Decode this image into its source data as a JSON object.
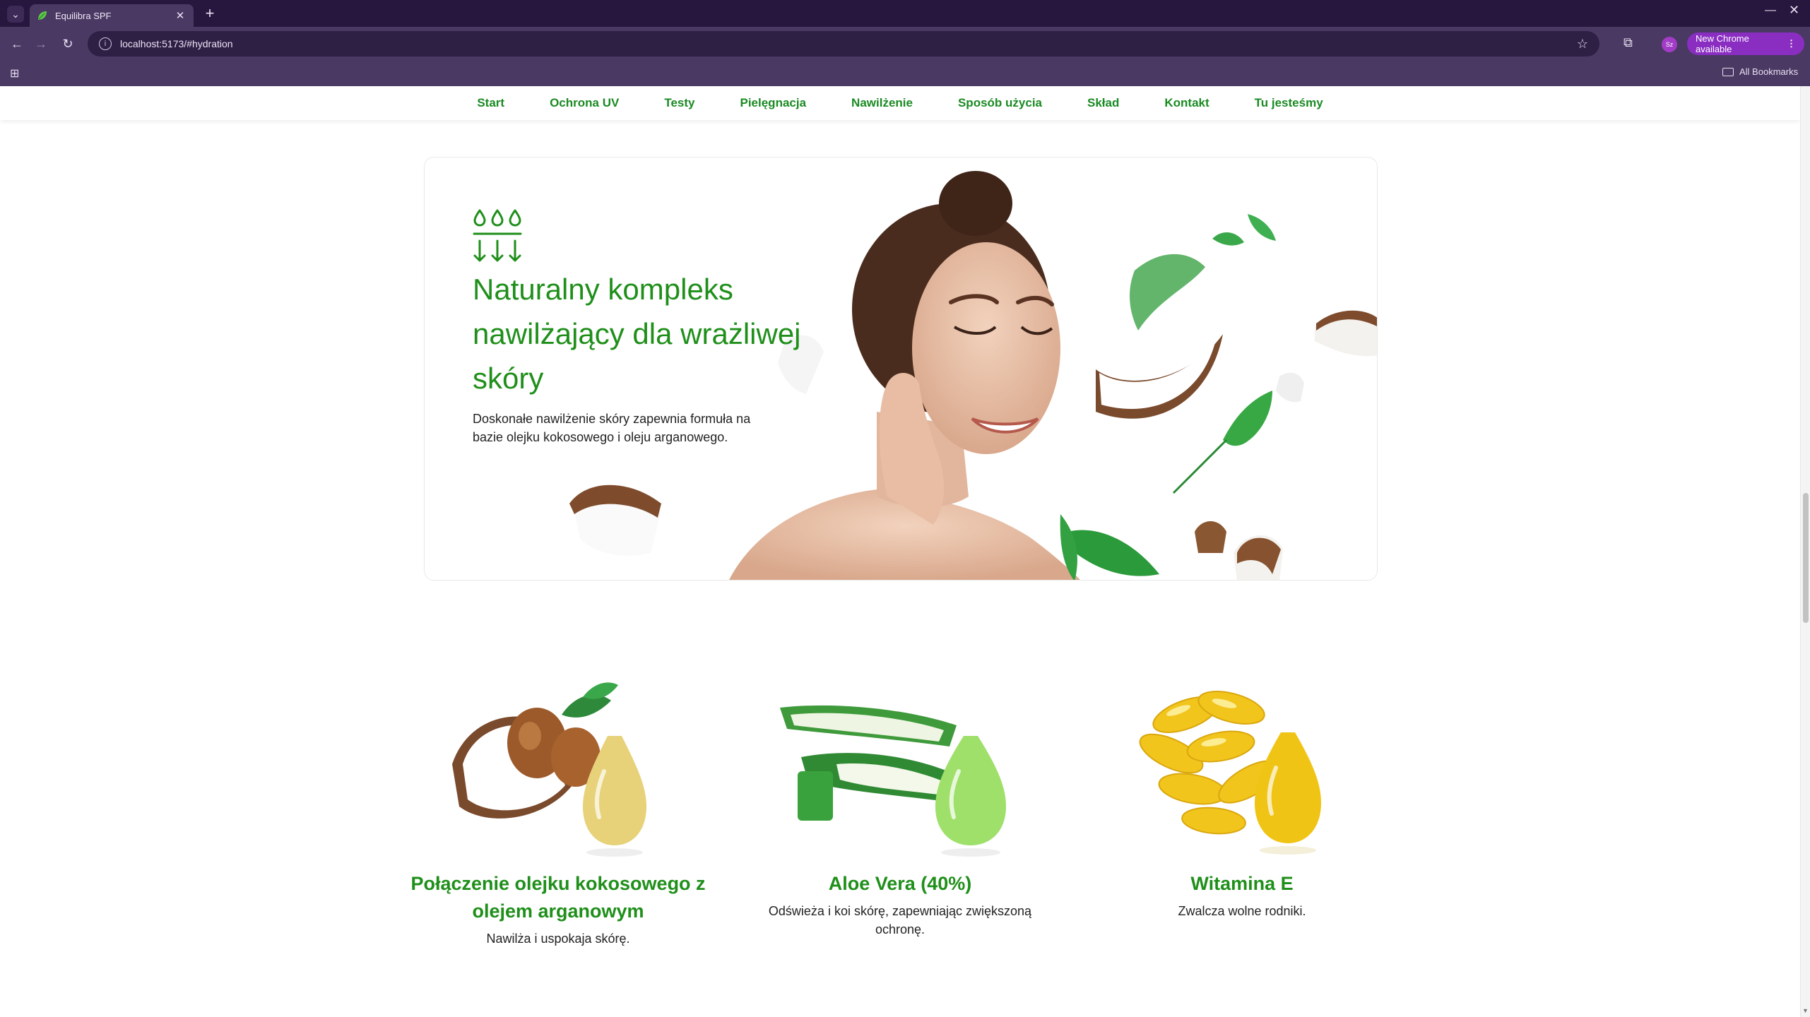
{
  "browser": {
    "tab_title": "Equilibra SPF",
    "url": "localhost:5173/#hydration",
    "update_button": "New Chrome available",
    "bookmarks_label": "All Bookmarks",
    "profile_initials": "Sz"
  },
  "nav": {
    "items": [
      "Start",
      "Ochrona UV",
      "Testy",
      "Pielęgnacja",
      "Nawilżenie",
      "Sposób użycia",
      "Skład",
      "Kontakt",
      "Tu jesteśmy"
    ]
  },
  "hero": {
    "title": "Naturalny kompleks nawilżający dla wrażliwej skóry",
    "description": "Doskonałe nawilżenie skóry zapewnia formuła na bazie olejku kokosowego i oleju arganowego."
  },
  "features": [
    {
      "title": "Połączenie olejku kokosowego z olejem arganowym",
      "text": "Nawilża i uspokaja skórę."
    },
    {
      "title": "Aloe Vera (40%)",
      "text": "Odświeża i koi skórę, zapewniając zwiększoną ochronę."
    },
    {
      "title": "Witamina E",
      "text": "Zwalcza wolne rodniki."
    }
  ],
  "colors": {
    "brand_green": "#1f8f1a",
    "chrome_dark": "#27163d",
    "chrome_toolbar": "#4a3963",
    "update_purple": "#8a2ec2"
  }
}
